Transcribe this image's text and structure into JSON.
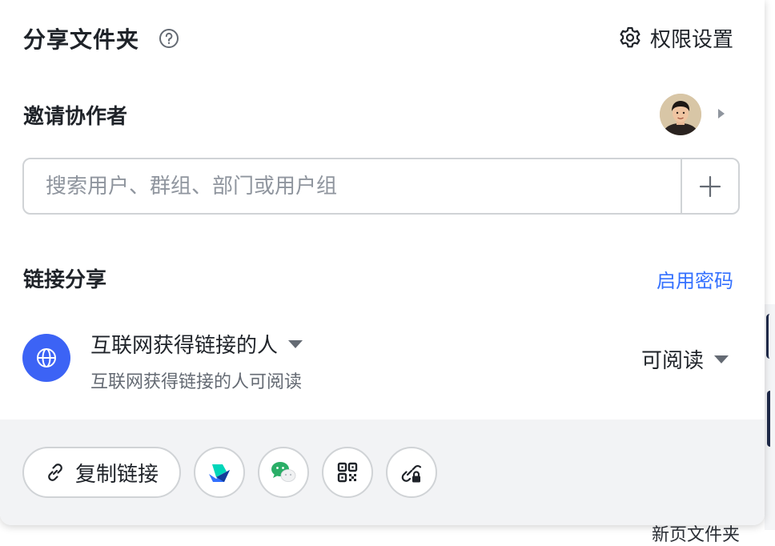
{
  "dialog": {
    "title": "分享文件夹",
    "permission_settings_label": "权限设置"
  },
  "invite": {
    "label": "邀请协作者",
    "search_placeholder": "搜索用户、群组、部门或用户组"
  },
  "link_share": {
    "label": "链接分享",
    "enable_password_label": "启用密码",
    "scope_label": "互联网获得链接的人",
    "scope_description": "互联网获得链接的人可阅读",
    "permission_label": "可阅读"
  },
  "footer": {
    "copy_link_label": "复制链接"
  },
  "background": {
    "partial_text": "新页文件夹"
  },
  "colors": {
    "accent": "#3370ff",
    "globe_bg": "#3c63f5",
    "footer_bg": "#f2f3f5",
    "wechat_green": "#2aae67"
  }
}
